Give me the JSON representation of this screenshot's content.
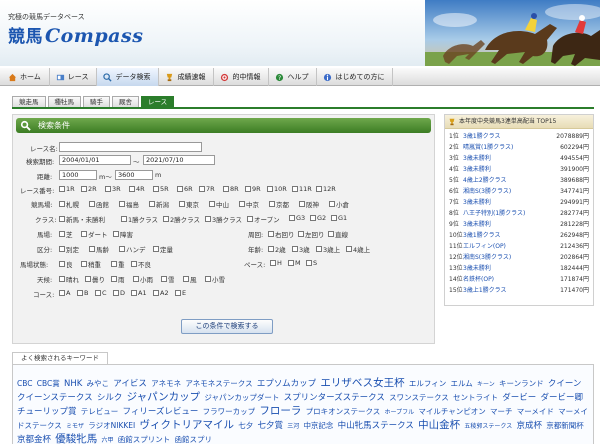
{
  "header": {
    "tagline": "究極の競馬データベース",
    "logo_prefix": "競馬",
    "logo_name": "Compass"
  },
  "nav": [
    {
      "label": "ホーム",
      "icon": "home-icon"
    },
    {
      "label": "レース",
      "icon": "race-icon"
    },
    {
      "label": "データ検索",
      "icon": "search-icon",
      "active": true
    },
    {
      "label": "成績速報",
      "icon": "trophy-icon"
    },
    {
      "label": "的中情報",
      "icon": "target-icon"
    },
    {
      "label": "ヘルプ",
      "icon": "help-icon"
    },
    {
      "label": "はじめての方に",
      "icon": "info-icon"
    }
  ],
  "subtabs": [
    "競走馬",
    "種牡馬",
    "騎手",
    "厩舎",
    "レース"
  ],
  "search": {
    "title": "検索条件",
    "race_name_label": "レース名:",
    "race_name_value": "",
    "period_label": "検索期間:",
    "period_from": "2004/01/01",
    "period_sep": "～",
    "period_to": "2021/07/10",
    "distance_label": "距離:",
    "distance_from": "1000",
    "distance_unit1": "m～",
    "distance_to": "3600",
    "distance_unit2": "m",
    "race_no_label": "レース番号:",
    "race_no": [
      "1R",
      "2R",
      "3R",
      "4R",
      "5R",
      "6R",
      "7R",
      "8R",
      "9R",
      "10R",
      "11R",
      "12R"
    ],
    "course_label": "競馬場:",
    "courses": [
      "札幌",
      "函館",
      "福島",
      "新潟",
      "東京",
      "中山",
      "中京",
      "京都",
      "阪神",
      "小倉"
    ],
    "class_label": "クラス:",
    "classes": [
      "新馬・未勝利",
      "1勝クラス",
      "2勝クラス",
      "3勝クラス",
      "オープン",
      "G3",
      "G2",
      "G1"
    ],
    "surface_label": "馬場:",
    "surfaces": [
      "芝",
      "ダート",
      "障害"
    ],
    "turn_label": "周回:",
    "turns": [
      "右回り",
      "左回り",
      "直線"
    ],
    "div_label": "区分:",
    "divs": [
      "別定",
      "馬齢",
      "ハンデ",
      "定量"
    ],
    "age_label": "年齢:",
    "ages": [
      "2歳",
      "3歳",
      "3歳上",
      "4歳上"
    ],
    "cond_label": "馬場状態:",
    "conds": [
      "良",
      "稍重",
      "重",
      "不良"
    ],
    "pace_label": "ペース:",
    "paces": [
      "H",
      "M",
      "S"
    ],
    "weather_label": "天候:",
    "weathers": [
      "晴れ",
      "曇り",
      "雨",
      "小雨",
      "雪",
      "風",
      "小雪"
    ],
    "corner_label": "コース:",
    "corners": [
      "A",
      "B",
      "C",
      "D",
      "A1",
      "A2",
      "E"
    ],
    "submit_label": "この条件で検索する"
  },
  "ranking": {
    "title": "本年度中央競馬3連単高配当 TOP15",
    "rows": [
      {
        "rank": "1位",
        "race": "3歳1勝クラス",
        "payout": "2078889円"
      },
      {
        "rank": "2位",
        "race": "晴嵐賞(1勝クラス)",
        "payout": "602294円"
      },
      {
        "rank": "3位",
        "race": "3歳未勝利",
        "payout": "494554円"
      },
      {
        "rank": "4位",
        "race": "3歳未勝利",
        "payout": "391900円"
      },
      {
        "rank": "5位",
        "race": "4歳上2勝クラス",
        "payout": "389688円"
      },
      {
        "rank": "6位",
        "race": "湘南S(3勝クラス)",
        "payout": "347741円"
      },
      {
        "rank": "7位",
        "race": "3歳未勝利",
        "payout": "294991円"
      },
      {
        "rank": "8位",
        "race": "八王子特別(1勝クラス)",
        "payout": "282774円"
      },
      {
        "rank": "9位",
        "race": "3歳未勝利",
        "payout": "281228円"
      },
      {
        "rank": "10位",
        "race": "3歳1勝クラス",
        "payout": "262948円"
      },
      {
        "rank": "11位",
        "race": "エルフィン(OP)",
        "payout": "212436円"
      },
      {
        "rank": "12位",
        "race": "湘南S(3勝クラス)",
        "payout": "202864円"
      },
      {
        "rank": "13位",
        "race": "3歳未勝利",
        "payout": "182444円"
      },
      {
        "rank": "14位",
        "race": "名鉄杯(OP)",
        "payout": "171874円"
      },
      {
        "rank": "15位",
        "race": "3歳上1勝クラス",
        "payout": "171470円"
      }
    ]
  },
  "keywords": {
    "title": "よく検索されるキーワード",
    "items": [
      {
        "t": "CBC",
        "s": 1
      },
      {
        "t": "CBC賞",
        "s": 1
      },
      {
        "t": "NHK",
        "s": 2
      },
      {
        "t": "みやこ",
        "s": 1
      },
      {
        "t": "アイビス",
        "s": 2
      },
      {
        "t": "アネモネ",
        "s": 1
      },
      {
        "t": "アネモネステークス",
        "s": 1
      },
      {
        "t": "エプソムカップ",
        "s": 2
      },
      {
        "t": "エリザベス女王杯",
        "s": 3
      },
      {
        "t": "エルフィン",
        "s": 1
      },
      {
        "t": "エルム",
        "s": 1
      },
      {
        "t": "キーン",
        "s": 0
      },
      {
        "t": "キーンランド",
        "s": 1
      },
      {
        "t": "クイーン",
        "s": 2
      },
      {
        "t": "クイーンステークス",
        "s": 2
      },
      {
        "t": "シルク",
        "s": 2
      },
      {
        "t": "ジャパンカップ",
        "s": 3
      },
      {
        "t": "ジャパンカップダート",
        "s": 1
      },
      {
        "t": "スプリンターズステークス",
        "s": 2
      },
      {
        "t": "スワンステークス",
        "s": 1
      },
      {
        "t": "セントライト",
        "s": 1
      },
      {
        "t": "ダービー",
        "s": 2
      },
      {
        "t": "ダービー卿",
        "s": 2
      },
      {
        "t": "チューリップ賞",
        "s": 2
      },
      {
        "t": "テレビュー",
        "s": 1
      },
      {
        "t": "フィリーズレビュー",
        "s": 2
      },
      {
        "t": "フラワーカップ",
        "s": 1
      },
      {
        "t": "フローラ",
        "s": 3
      },
      {
        "t": "プロキオンステークス",
        "s": 1
      },
      {
        "t": "ホープフル",
        "s": 0
      },
      {
        "t": "マイルチャンピオン",
        "s": 1
      },
      {
        "t": "マーチ",
        "s": 1
      },
      {
        "t": "マーメイド",
        "s": 1
      },
      {
        "t": "マーメイドステークス",
        "s": 1
      },
      {
        "t": "ミモザ",
        "s": 0
      },
      {
        "t": "ラジオNIKKEI",
        "s": 1
      },
      {
        "t": "ヴィクトリアマイル",
        "s": 3
      },
      {
        "t": "七夕",
        "s": 1
      },
      {
        "t": "七夕賞",
        "s": 2
      },
      {
        "t": "三河",
        "s": 0
      },
      {
        "t": "中京記念",
        "s": 1
      },
      {
        "t": "中山牝馬ステークス",
        "s": 2
      },
      {
        "t": "中山金杯",
        "s": 3
      },
      {
        "t": "五稜郭ステークス",
        "s": 0
      },
      {
        "t": "京成杯",
        "s": 2
      },
      {
        "t": "京都新聞杯",
        "s": 1
      },
      {
        "t": "京都金杯",
        "s": 2
      },
      {
        "t": "優駿牝馬",
        "s": 3
      },
      {
        "t": "六甲",
        "s": 0
      },
      {
        "t": "函館スプリント",
        "s": 1
      },
      {
        "t": "函館スプリ",
        "s": 1
      }
    ]
  },
  "colors": {
    "accent_green": "#2b7d2b",
    "link_blue": "#1a4fb0",
    "logo_blue": "#1c56b0"
  }
}
